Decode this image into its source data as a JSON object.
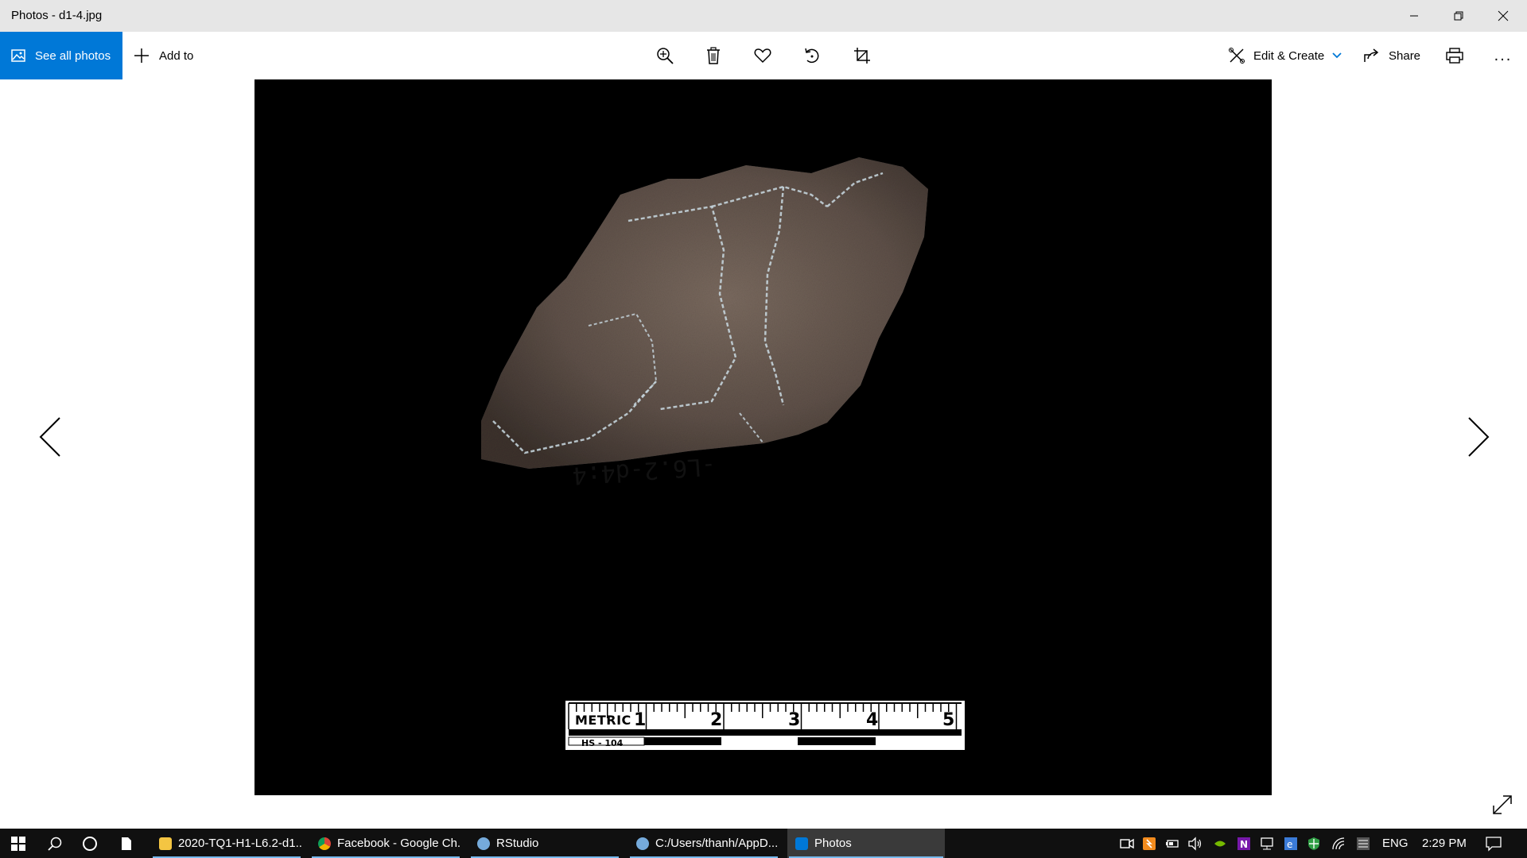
{
  "window": {
    "title": "Photos - d1-4.jpg",
    "controls": [
      "minimize-icon",
      "restore-icon",
      "close-icon"
    ]
  },
  "toolbar": {
    "see_all_photos": "See all photos",
    "add_to": "Add to",
    "tools": [
      "zoom-in-icon",
      "delete-icon",
      "favorite-icon",
      "rotate-icon",
      "crop-icon"
    ],
    "edit_create": "Edit & Create",
    "share": "Share",
    "print_icon": "print-icon",
    "more": "..."
  },
  "photo": {
    "subject": "stone-artifact",
    "ruler": {
      "metric_label": "METRIC",
      "model": "HS - 104",
      "numbers": [
        "1",
        "2",
        "3",
        "4",
        "5"
      ]
    }
  },
  "taskbar": {
    "apps": [
      {
        "label": "2020-TQ1-H1-L6.2-d1...",
        "icon": "folder-icon",
        "color": "#f4c542",
        "running": true
      },
      {
        "label": "Facebook - Google Ch...",
        "icon": "chrome-icon",
        "color": "#db4437",
        "running": true
      },
      {
        "label": "RStudio",
        "icon": "rstudio-icon",
        "color": "#75aadb",
        "running": true
      },
      {
        "label": "C:/Users/thanh/AppD...",
        "icon": "r-console-icon",
        "color": "#75aadb",
        "running": true
      },
      {
        "label": "Photos",
        "icon": "photos-icon",
        "color": "#0078d7",
        "running": true,
        "active": true
      }
    ],
    "language": "ENG",
    "time": "2:29 PM"
  },
  "colors": {
    "accent": "#0078d7",
    "titlebar": "#e6e6e6",
    "taskbar": "#101010"
  }
}
